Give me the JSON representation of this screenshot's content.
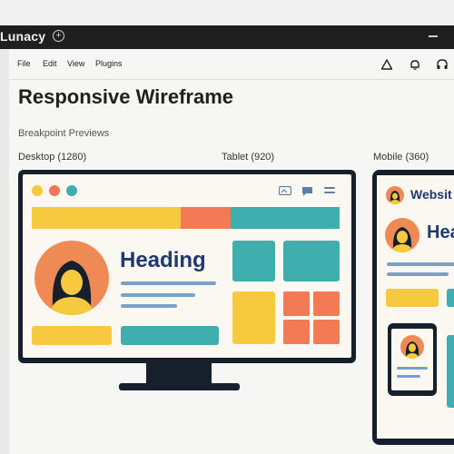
{
  "window": {
    "app_name": "Lunacy",
    "new_tab_icon": "plus-circle-icon",
    "minimize_icon": "minimize-icon"
  },
  "menu": {
    "items": [
      "File",
      "Edit",
      "View",
      "Plugins"
    ],
    "tool_icons": [
      "triangle-icon",
      "bell-icon",
      "headphones-icon"
    ]
  },
  "page": {
    "title": "Responsive Wireframe",
    "section_label": "Breakpoint Previews",
    "breakpoints": {
      "desktop": "Desktop (1280)",
      "tablet": "Tablet (920)",
      "mobile": "Mobile (360)"
    }
  },
  "desktop_mock": {
    "heading": "Heading",
    "icons": [
      "image-icon",
      "chat-icon",
      "menu-icon"
    ]
  },
  "tablet_mock": {
    "header_text": "Websit",
    "heading": "Hea"
  },
  "colors": {
    "yellow": "#f7c93e",
    "coral": "#f27a55",
    "teal": "#3eaeae",
    "navy": "#15202c",
    "heading_blue": "#1f3a70"
  }
}
